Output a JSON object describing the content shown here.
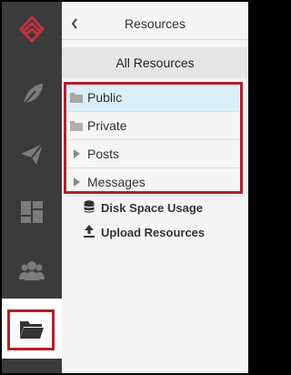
{
  "sidebar": {
    "items": [
      {
        "icon": "logo-icon",
        "label": ""
      },
      {
        "icon": "feather-icon",
        "label": ""
      },
      {
        "icon": "send-icon",
        "label": ""
      },
      {
        "icon": "dashboard-icon",
        "label": ""
      },
      {
        "icon": "users-icon",
        "label": ""
      },
      {
        "icon": "folder-icon",
        "label": "",
        "active": true
      }
    ],
    "bg": "#3b3b3b",
    "logo_color": "#c3303d",
    "icon_color": "#7b7b7b",
    "active_icon_color": "#333333"
  },
  "panel": {
    "title": "Resources",
    "subtitle": "All Resources",
    "resources": [
      {
        "label": "Public",
        "icon": "folder-icon",
        "selected": true
      },
      {
        "label": "Private",
        "icon": "folder-icon",
        "selected": false
      },
      {
        "label": "Posts",
        "icon": "caret-right-icon",
        "selected": false
      },
      {
        "label": "Messages",
        "icon": "caret-right-icon",
        "selected": false
      }
    ],
    "actions": [
      {
        "label": "Disk Space Usage",
        "icon": "database-icon"
      },
      {
        "label": "Upload Resources",
        "icon": "upload-icon"
      }
    ]
  },
  "colors": {
    "highlight_border": "#b3202b",
    "selected_row": "#dbeff9"
  }
}
